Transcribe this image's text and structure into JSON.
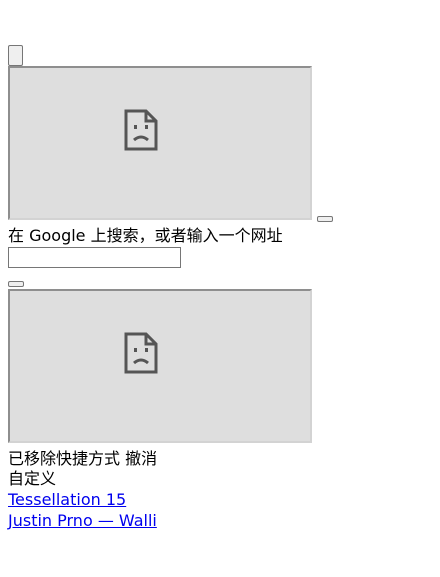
{
  "search": {
    "hint": "在 Google 上搜索，或者输入一个网址",
    "input_value": ""
  },
  "notification": {
    "removed_text": "已移除快捷方式",
    "undo_label": "撤消"
  },
  "customize_label": "自定义",
  "links": [
    {
      "label": "Tessellation 15"
    },
    {
      "label": "Justin Prno — Walli"
    }
  ],
  "icons": {
    "broken_frame": "broken-page-icon"
  },
  "colors": {
    "frame_bg": "#dedede",
    "link": "#0000ee"
  }
}
